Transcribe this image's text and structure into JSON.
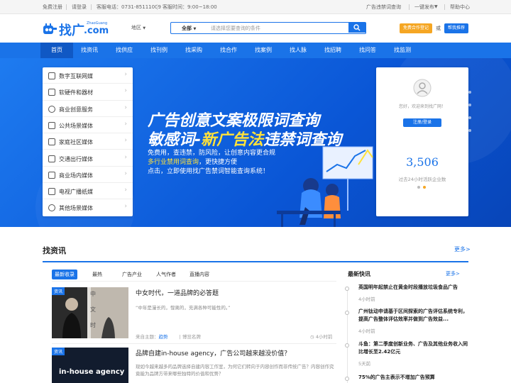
{
  "topbar": {
    "register": "免费注册",
    "login": "请登录",
    "phone": "客服电话：0731-85111009",
    "hours": "客服时间：9:00~18:00",
    "violation_query": "广告违禁词查询",
    "publish": "一键发布",
    "help": "帮助中心"
  },
  "header": {
    "logo_cn": "找广",
    "logo_en": "ZhaoGuang",
    "logo_com": ".com",
    "region": "地区",
    "search_scope": "全部",
    "search_placeholder": "请选择您要查询的条件",
    "partner_btn": "免费合作登记",
    "or": "或",
    "recommend_btn": "帮我推荐"
  },
  "nav": [
    "首页",
    "找资讯",
    "找供应",
    "找刊例",
    "找采购",
    "找合作",
    "找案例",
    "找人脉",
    "找招聘",
    "找问答",
    "找监测"
  ],
  "categories": [
    "数字互联网媒",
    "软硬件和器材",
    "商业创意服务",
    "公共场景媒体",
    "家庭社区媒体",
    "交通出行媒体",
    "商业场内媒体",
    "电视广播纸媒",
    "其他场景媒体"
  ],
  "banner": {
    "headline1": "广告创意文案极限词查询",
    "headline2a": "敏感词-",
    "headline2b": "新广告法",
    "headline2c": "违禁词查询",
    "line1": "免费用，查违禁，防风险，让创意内容更合规",
    "line2a": "多行业禁用词查询",
    "line2b": "，更快捷方便",
    "line3": "点击，立即使用找广告禁词智能查询系统！"
  },
  "login_panel": {
    "welcome": "您好，欢迎来到找广网！",
    "button": "注册/登录",
    "count": "3,506",
    "count_label": "过去24小时活跃企业数"
  },
  "zixun": {
    "title": "找资讯",
    "more": "更多>",
    "tabs": [
      "最新收录",
      "最热",
      "广告产业",
      "人气作者",
      "直播内容"
    ],
    "articles": [
      {
        "badge": "资讯",
        "title": "中女时代，一道品牌的必答题",
        "excerpt": "“中年是漫长的，惶离的，充满各种可能性的。”",
        "source_label": "来自主题：",
        "source": "趋势",
        "author": "博览名牌",
        "time": "4小时前",
        "image_caption_1": "中",
        "image_caption_2": "文",
        "image_caption_3": "时"
      },
      {
        "badge": "资讯",
        "title": "品牌自建in-house agency，广告公司越来越没价值？",
        "excerpt": "现如今越来越多的品牌选择自建内容工作室，为何它们转向于内容创作而非传统广告？内容创作究竟能为品牌方带来哪些独特的价值和优势？",
        "image_text": "in-house agency"
      }
    ]
  },
  "flash": {
    "title": "最新快讯",
    "more": "更多>",
    "items": [
      {
        "title": "英国明年起禁止在黄金时段播放垃圾食品广告",
        "date": "4小时前"
      },
      {
        "title": "广州钛动申请基于区间探索的广告评估系统专利，提高广告整体评估效率并做到广告效益...",
        "date": "4小时前"
      },
      {
        "title": "斗鱼：第二季度创新业务、广告及其他业务收入同比增长至2.42亿元",
        "date": "5天前"
      },
      {
        "title": "75%的广告主表示不增加广告预算",
        "date": ""
      }
    ]
  },
  "colors": {
    "brand": "#1a73e8",
    "nav": "#1a73e8",
    "partner": "#f5a623",
    "headline_yellow": "#ffe23a"
  }
}
